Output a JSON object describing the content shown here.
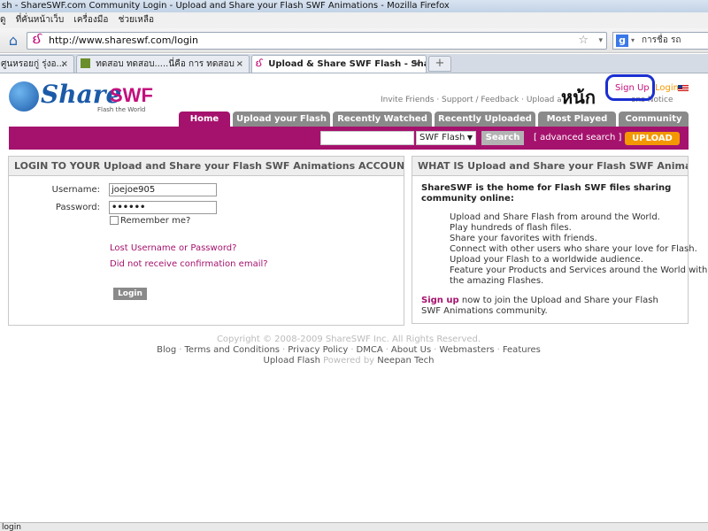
{
  "window": {
    "title": "sh - ShareSWF.com Community Login - Upload and Share your Flash SWF Animations - Mozilla Firefox"
  },
  "menu": [
    "ดู",
    "ที่คั่นหน้าเว็บ",
    "เครื่องมือ",
    "ช่วยเหลือ"
  ],
  "address": {
    "url": "http://www.shareswf.com/login",
    "search_placeholder": "การชื่อ รถ"
  },
  "tabs": [
    {
      "label": "ศูนหรอยกู่ รุ่งอ..."
    },
    {
      "label": "ทดสอบ ทดสอบ.....นี่คือ การ ทดสอบ"
    },
    {
      "label": "Upload & Share SWF Flash - Shar..."
    }
  ],
  "site": {
    "logo_share": "Share",
    "logo_swf": "SWF",
    "logo_tagline": "Flash the World",
    "top_links": "Invite Friends · Support / Feedback · Upload and Sha",
    "signup": "Sign Up",
    "login": "Login",
    "notice": "ons Notice",
    "annotation": "หน้ก",
    "nav": [
      "Home",
      "Upload your Flash",
      "Recently Watched",
      "Recently Uploaded",
      "Most Played",
      "Community"
    ],
    "search": {
      "type": "SWF Flash",
      "button": "Search",
      "advanced": "[ advanced search ]",
      "upload": "UPLOAD"
    }
  },
  "login": {
    "heading": "LOGIN TO YOUR Upload and Share your Flash SWF Animations ACCOUNT",
    "username_label": "Username:",
    "username_value": "joejoe905",
    "password_label": "Password:",
    "password_value": "••••••",
    "remember": "Remember me?",
    "lost": "Lost Username or Password?",
    "confirm": "Did not receive confirmation email?",
    "button": "Login"
  },
  "what": {
    "heading": "WHAT IS Upload and Share your Flash SWF Animations?",
    "intro": "ShareSWF is the home for Flash SWF files sharing community online:",
    "items": [
      "Upload and Share Flash from around the World.",
      "Play hundreds of flash files.",
      "Share your favorites with friends.",
      "Connect with other users who share your love for Flash.",
      "Upload your Flash to a worldwide audience.",
      "Feature your Products and Services around the World with",
      "the amazing Flashes."
    ],
    "footer_link": "Sign up",
    "footer_text": " now to join the Upload and Share your Flash SWF Animations community."
  },
  "footer": {
    "copyright": "Copyright © 2008-2009 ShareSWF Inc. All Rights Reserved.",
    "links": [
      "Blog",
      "Terms and Conditions",
      "Privacy Policy",
      "DMCA",
      "About Us",
      "Webmasters",
      "Features"
    ],
    "line2_a": "Upload Flash",
    "line2_b": " Powered by ",
    "line2_c": "Neepan Tech"
  },
  "status": "login"
}
